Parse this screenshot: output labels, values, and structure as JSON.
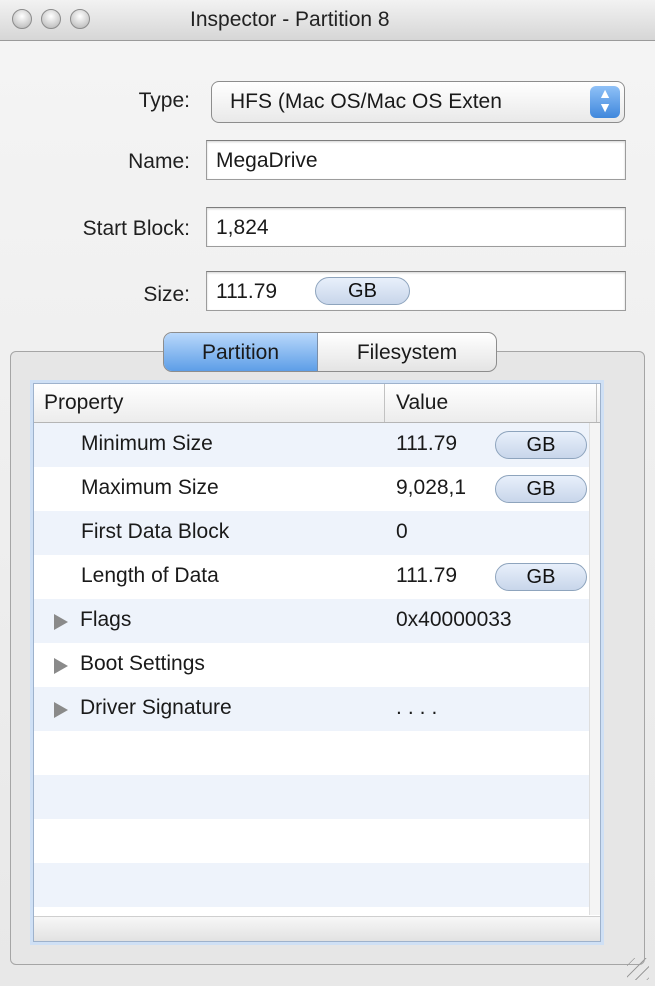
{
  "window": {
    "title": "Inspector - Partition 8"
  },
  "form": {
    "type_label": "Type:",
    "type_value": "HFS (Mac OS/Mac OS Exten",
    "name_label": "Name:",
    "name_value": "MegaDrive",
    "start_block_label": "Start Block:",
    "start_block_value": "1,824",
    "size_label": "Size:",
    "size_value": "111.79",
    "size_unit": "GB"
  },
  "tabs": [
    {
      "label": "Partition",
      "selected": true
    },
    {
      "label": "Filesystem",
      "selected": false
    }
  ],
  "table": {
    "headers": [
      "Property",
      "Value"
    ],
    "rows": [
      {
        "property": "Minimum Size",
        "value": "111.79",
        "unit": "GB"
      },
      {
        "property": "Maximum Size",
        "value": "9,028,1",
        "unit": "GB"
      },
      {
        "property": "First Data Block",
        "value": "0"
      },
      {
        "property": "Length of Data",
        "value": "111.79",
        "unit": "GB"
      },
      {
        "property": "Flags",
        "value": "0x40000033",
        "expandable": true
      },
      {
        "property": "Boot Settings",
        "value": "",
        "expandable": true
      },
      {
        "property": "Driver Signature",
        "value": "....",
        "expandable": true
      }
    ]
  },
  "icons": {
    "close": "close-button-icon",
    "minimize": "minimize-button-icon",
    "zoom": "zoom-button-icon",
    "disclosure": "disclosure-triangle-icon",
    "popup": "popup-arrows-icon",
    "resize": "resize-grip-icon"
  },
  "colors": {
    "selection_blue": "#5d9ee7",
    "table_stripe": "#eef3fb"
  }
}
